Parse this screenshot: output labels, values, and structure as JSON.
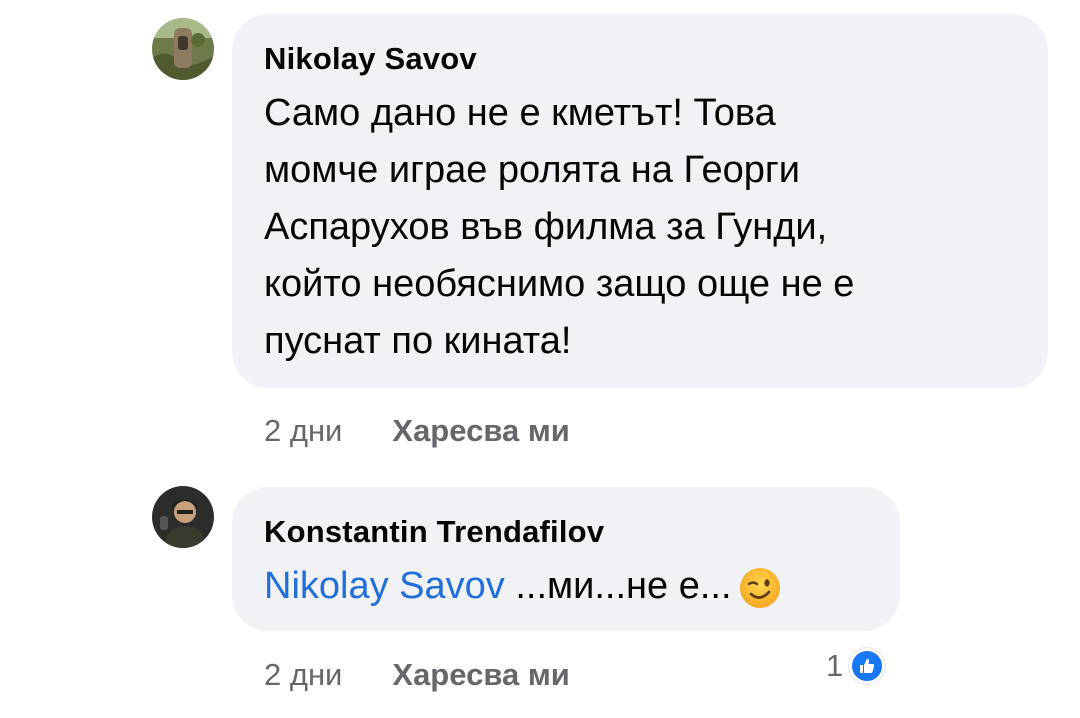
{
  "comments": [
    {
      "author": "Nikolay Savov",
      "text_lines": [
        "Само дано не е кметът! Това",
        "момче играе ролята на Георги",
        "Аспарухов във филма за Гунди,",
        "който необяснимо защо още не е",
        "пуснат по кината!"
      ],
      "time": "2 дни",
      "like_label": "Харесва ми"
    },
    {
      "author": "Konstantin Trendafilov",
      "mention": "Nikolay Savov",
      "text": " ...ми...не е...",
      "emoji": "winking-face-emoji",
      "time": "2 дни",
      "like_label": "Харесва ми",
      "reaction_count": "1",
      "reaction_icon": "thumbs-up-icon"
    }
  ],
  "colors": {
    "bubble": "#f0f2f5",
    "mention": "#216fdb",
    "meta": "#65676b",
    "like_badge": "#1877f2"
  }
}
